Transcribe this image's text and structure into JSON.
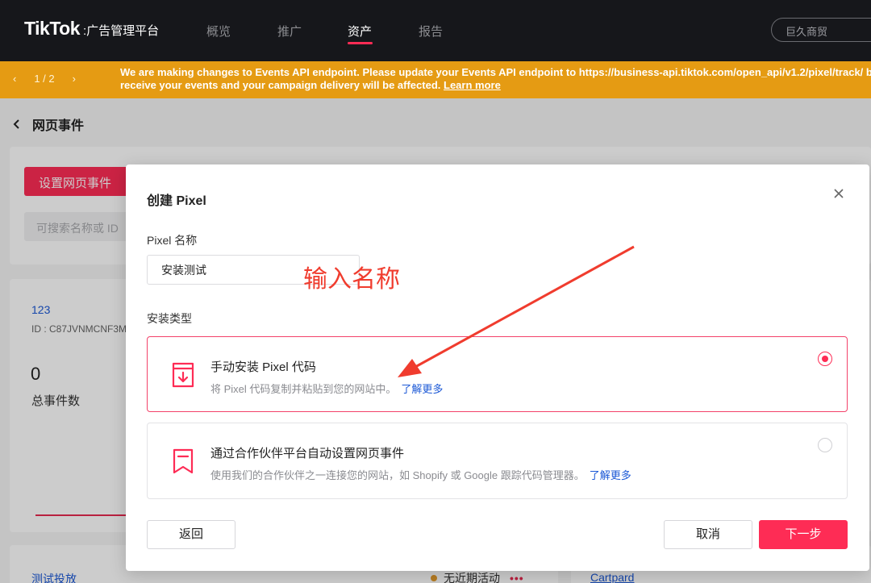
{
  "colors": {
    "brand": "#fe2c55",
    "topbar": "#16171b",
    "notice": "#e59b13",
    "link": "#1b58d6",
    "annotation": "#f03c2e"
  },
  "topnav": {
    "logo": "TikTok",
    "logo_sub": ":广告管理平台",
    "items": [
      {
        "label": "概览"
      },
      {
        "label": "推广"
      },
      {
        "label": "资产"
      },
      {
        "label": "报告"
      }
    ],
    "active_item": "资产",
    "account": "巨久商贸"
  },
  "notice": {
    "pager": {
      "prev": "‹",
      "text": "1 / 2",
      "next": "›"
    },
    "line1": "We are making changes to Events API endpoint. Please update your Events API endpoint to https://business-api.tiktok.com/open_api/v1.2/pixel/track/ before",
    "line2": "receive your events and your campaign delivery will be affected.",
    "learn_more": "Learn more"
  },
  "page": {
    "back_icon": "chevron-left-icon",
    "title": "网页事件",
    "setup_button": "设置网页事件",
    "search_placeholder": "可搜索名称或 ID",
    "pixel_name": "123",
    "pixel_id": "ID : C87JVNMCNF3M",
    "total_events_value": "0",
    "total_events_label": "总事件数",
    "test_link": "测试投放",
    "status_text": "无近期活动",
    "status_more": "•••",
    "partner_link": "Cartpard"
  },
  "modal": {
    "title": "创建 Pixel",
    "close_icon": "close-icon",
    "name_label": "Pixel 名称",
    "name_value": "安装测试",
    "type_label": "安装类型",
    "options": [
      {
        "icon": "download-box-icon",
        "title": "手动安装 Pixel 代码",
        "desc": "将 Pixel 代码复制并粘贴到您的网站中。",
        "more": "了解更多",
        "selected": true
      },
      {
        "icon": "bookmark-icon",
        "title": "通过合作伙伴平台自动设置网页事件",
        "desc": "使用我们的合作伙伴之一连接您的网站，如 Shopify 或 Google 跟踪代码管理器。",
        "more": "了解更多",
        "selected": false
      }
    ],
    "back_button": "返回",
    "cancel_button": "取消",
    "next_button": "下一步"
  },
  "annotation": {
    "text": "输入名称"
  }
}
